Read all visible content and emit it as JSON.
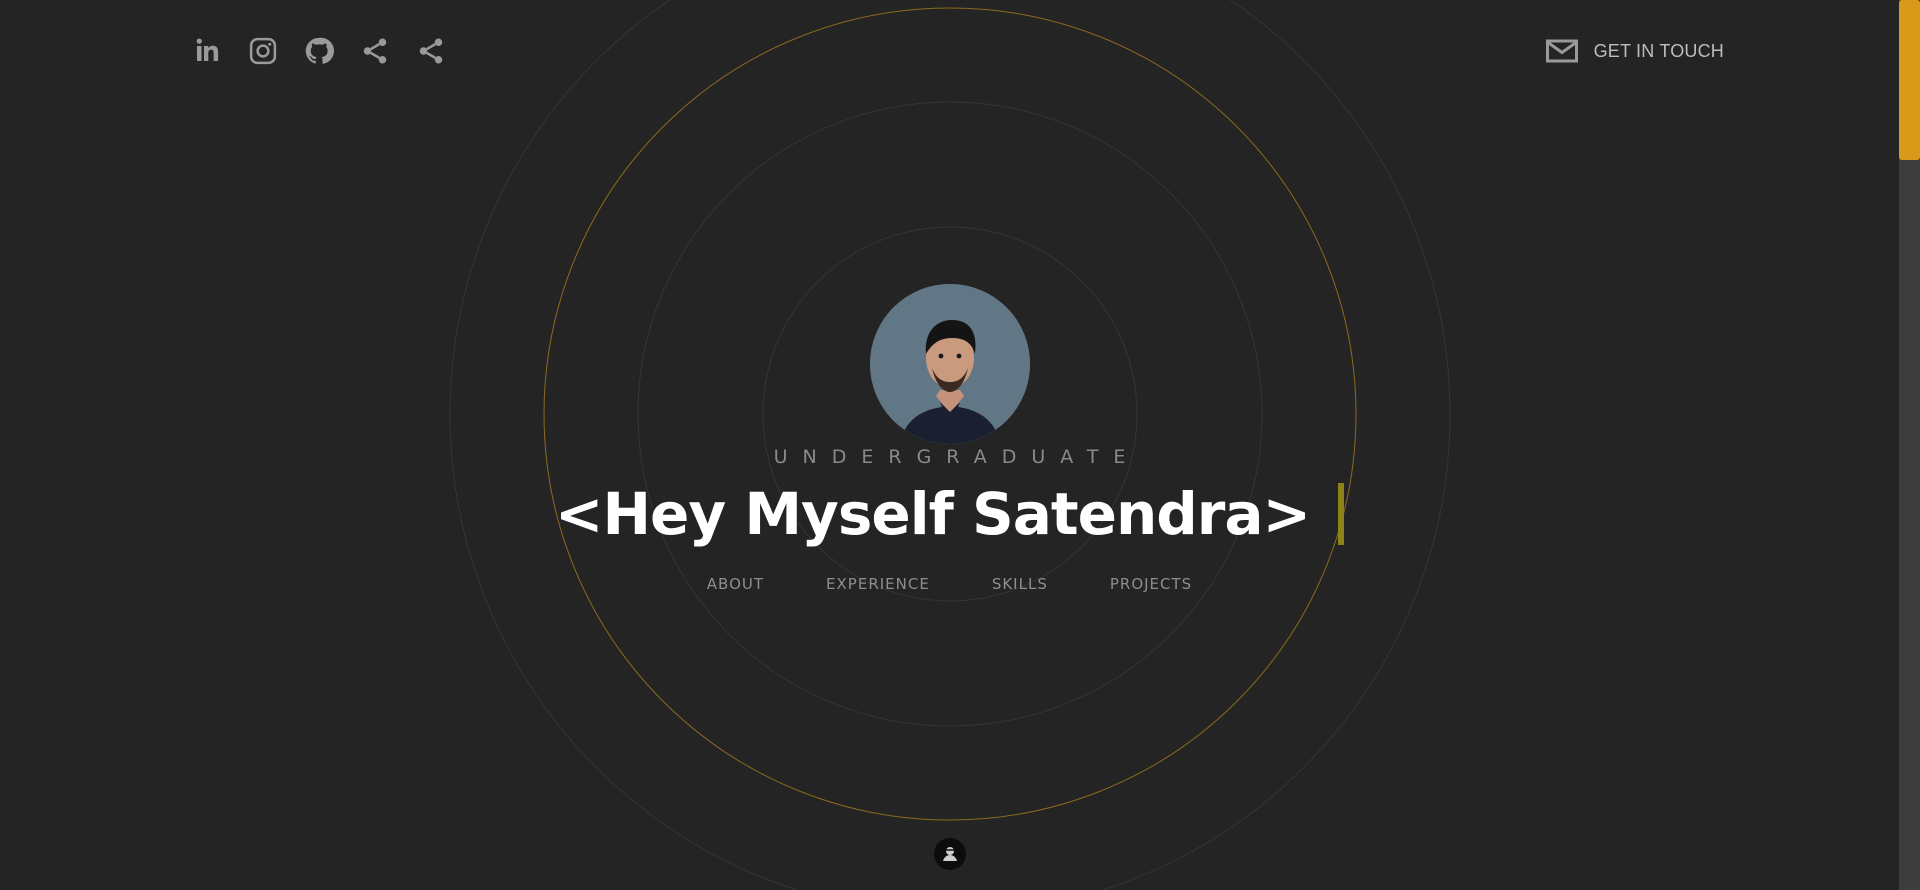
{
  "social": {
    "items": [
      {
        "name": "linkedin-icon"
      },
      {
        "name": "instagram-icon"
      },
      {
        "name": "github-icon"
      },
      {
        "name": "share-icon"
      },
      {
        "name": "share-icon"
      }
    ]
  },
  "contact": {
    "label": "GET IN TOUCH",
    "icon": "mail-icon"
  },
  "hero": {
    "tagline": "UNDERGRADUATE",
    "headline": "<Hey Myself Satendra>"
  },
  "nav": {
    "about": "ABOUT",
    "experience": "EXPERIENCE",
    "skills": "SKILLS",
    "projects": "PROJECTS"
  },
  "colors": {
    "background": "#242424",
    "accent": "#d89a18",
    "cursor": "#8c8418",
    "ring": "#3a3a3a",
    "accent_ring": "#8a6a1e"
  },
  "scroll": {
    "thumb_fraction": 0.18
  }
}
